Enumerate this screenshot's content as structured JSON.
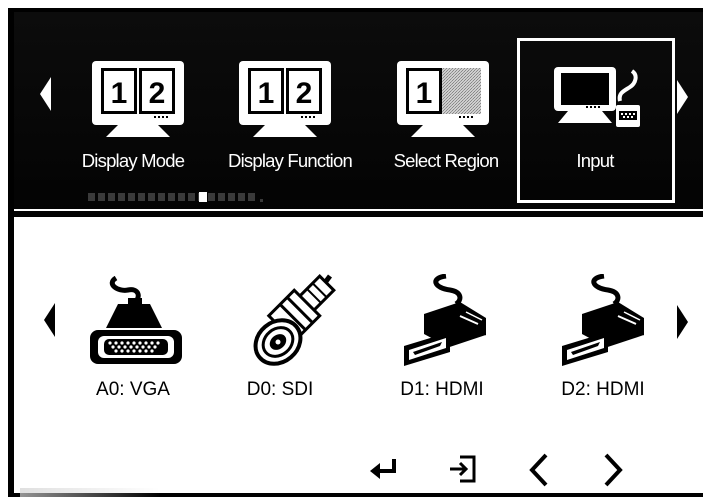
{
  "menu": {
    "items": [
      {
        "label": "Display Mode",
        "icon": "dual-monitor-icon",
        "left_num": "1",
        "right_num": "2"
      },
      {
        "label": "Display Function",
        "icon": "dual-monitor-icon",
        "left_num": "1",
        "right_num": "2"
      },
      {
        "label": "Select Region",
        "icon": "region-monitor-icon",
        "left_num": "1"
      },
      {
        "label": "Input",
        "icon": "input-computer-icon",
        "selected": true
      }
    ],
    "page_indicator": {
      "count": 14,
      "active_index": 6
    }
  },
  "sources": {
    "items": [
      {
        "label": "A0: VGA",
        "icon": "vga-connector-icon"
      },
      {
        "label": "D0: SDI",
        "icon": "bnc-connector-icon"
      },
      {
        "label": "D1: HDMI",
        "icon": "hdmi-connector-icon"
      },
      {
        "label": "D2: HDMI",
        "icon": "hdmi-connector-icon"
      }
    ]
  },
  "controls": [
    "enter-icon",
    "exit-icon",
    "left-chevron-icon",
    "right-chevron-icon"
  ],
  "colors": {
    "panel_bg": "#000000",
    "menu_text": "#ffffff",
    "source_text": "#000000"
  }
}
